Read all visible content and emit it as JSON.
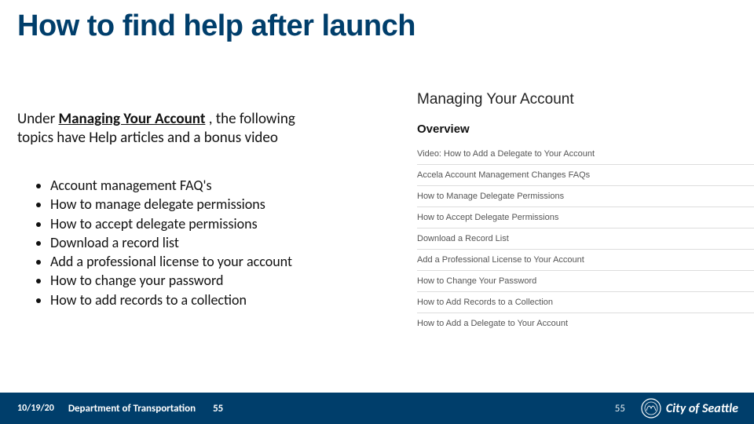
{
  "title": "How to find help after launch",
  "intro_pre": "Under ",
  "intro_link": "Managing Your Account",
  "intro_post": " , the following topics have Help articles and a bonus video",
  "bullets": [
    "Account management FAQ's",
    "How to manage delegate permissions",
    "How to accept delegate permissions",
    "Download a record list",
    "Add a professional license to your account",
    "How to change your password",
    "How to add records to a collection"
  ],
  "sidepanel": {
    "header": "Managing Your Account",
    "overview": "Overview",
    "rows": [
      "Video: How to Add a Delegate to Your Account",
      "Accela Account Management Changes FAQs",
      "How to Manage Delegate Permissions",
      "How to Accept Delegate Permissions",
      "Download a Record List",
      "Add a Professional License to Your Account",
      "How to Change Your Password",
      "How to Add Records to a Collection",
      "How to Add a Delegate to Your Account"
    ]
  },
  "footer": {
    "date": "10/19/20",
    "dept": "Department of Transportation",
    "page": "55",
    "page2": "55",
    "logo_text": "City of Seattle"
  }
}
